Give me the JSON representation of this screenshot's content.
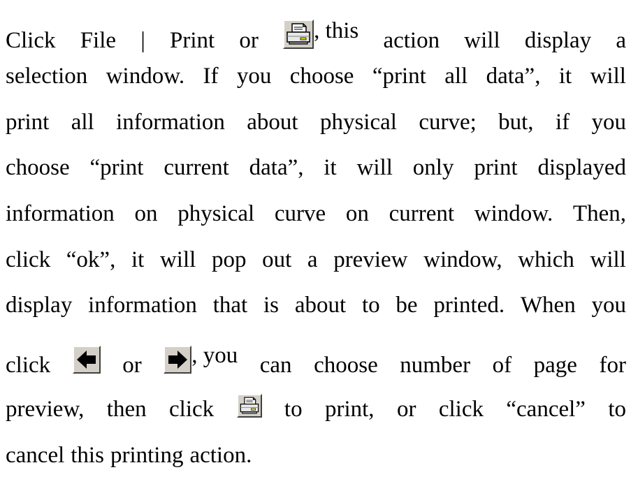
{
  "lines": [
    [
      "Click",
      "File",
      "|",
      "Print",
      "or",
      "[print-icon]",
      ", this",
      "action",
      "will",
      "display",
      "a"
    ],
    [
      "selection",
      "window.",
      "If",
      "you",
      "choose",
      "“print",
      "all",
      "data”,",
      "it",
      "will"
    ],
    [
      "print",
      "all",
      "information",
      "about",
      "physical",
      "curve;",
      "but,",
      "if",
      "you"
    ],
    [
      "choose",
      "“print",
      "current",
      "data”,",
      "it",
      "will",
      "only",
      "print",
      "displayed"
    ],
    [
      "information",
      "on",
      "physical",
      "curve",
      "on",
      "current",
      "window.",
      "Then,"
    ],
    [
      "click",
      "“ok”,",
      "it",
      "will",
      "pop",
      "out",
      "a",
      "preview",
      "window,",
      "which",
      "will"
    ],
    [
      "display",
      "information",
      "that",
      "is",
      "about",
      "to",
      "be",
      "printed.",
      "When",
      "you"
    ],
    [
      "click",
      "[left-arrow-icon]",
      "or",
      "[right-arrow-icon]",
      ", you",
      "can",
      "choose",
      "number",
      "of",
      "page",
      "for"
    ],
    [
      "preview,",
      "then",
      "click",
      "[print-icon]",
      "to",
      "print,",
      "or",
      "click",
      "“cancel”",
      "to"
    ],
    [
      "cancel",
      "this",
      "printing",
      "action."
    ]
  ],
  "icons": {
    "print": "printer-icon",
    "prev_page": "left-arrow-icon",
    "next_page": "right-arrow-icon"
  },
  "colors": {
    "text": "#000000",
    "button_face": "#d4d0c8",
    "arrow": "#000000",
    "printer_body": "#e8e8e8"
  }
}
